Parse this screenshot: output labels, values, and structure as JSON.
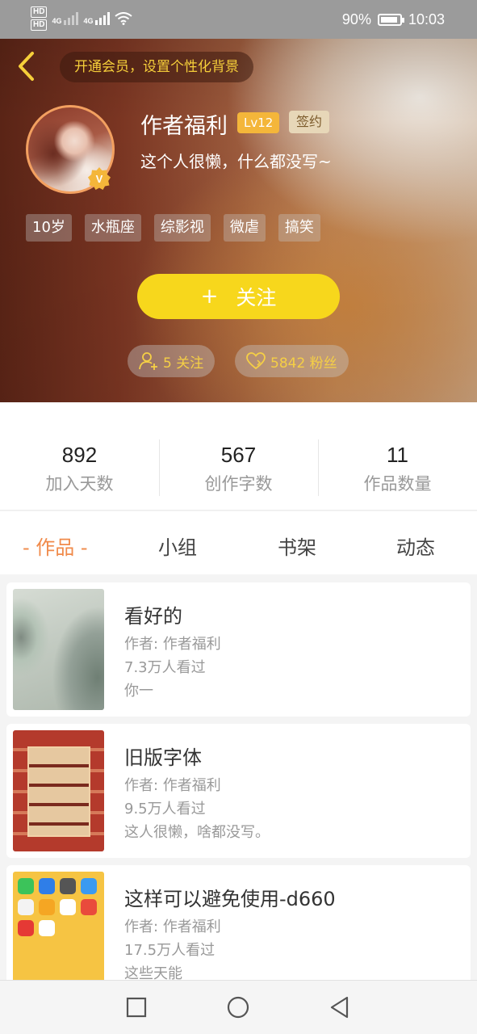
{
  "status_bar": {
    "hd1": "HD",
    "hd2": "HD",
    "net1": "4G",
    "net2": "4G",
    "battery_percent": "90%",
    "time": "10:03"
  },
  "header": {
    "vip_prompt": "开通会员，设置个性化背景",
    "username": "作者福利",
    "level": "Lv12",
    "signed_label": "签约",
    "bio": "这个人很懒，什么都没写~",
    "tags": [
      "10岁",
      "水瓶座",
      "综影视",
      "微虐",
      "搞笑"
    ],
    "follow_button": {
      "plus": "+",
      "label": "关注"
    },
    "following": "5 关注",
    "fans": "5842 粉丝",
    "accent_color": "#f7d71c"
  },
  "counts": [
    {
      "value": "892",
      "label": "加入天数"
    },
    {
      "value": "567",
      "label": "创作字数"
    },
    {
      "value": "11",
      "label": "作品数量"
    }
  ],
  "tabs": [
    {
      "label": "- 作品 -",
      "active": true
    },
    {
      "label": "小组",
      "active": false
    },
    {
      "label": "书架",
      "active": false
    },
    {
      "label": "动态",
      "active": false
    }
  ],
  "works": [
    {
      "title": "看好的",
      "author": "作者: 作者福利",
      "views": "7.3万人看过",
      "desc": "你一"
    },
    {
      "title": "旧版字体",
      "author": "作者: 作者福利",
      "views": "9.5万人看过",
      "desc": "这人很懒，啥都没写。"
    },
    {
      "title": "这样可以避免使用-d660",
      "author": "作者: 作者福利",
      "views": "17.5万人看过",
      "desc": "这些天能"
    }
  ],
  "nav": {
    "icons": [
      "recent-apps-icon",
      "home-icon",
      "back-icon"
    ]
  }
}
